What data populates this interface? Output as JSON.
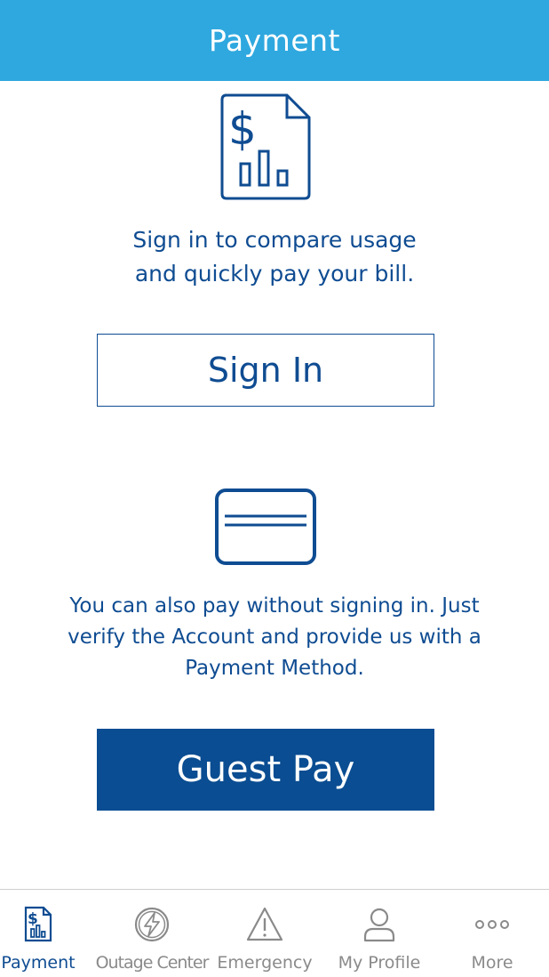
{
  "header": {
    "title": "Payment"
  },
  "signin_section": {
    "icon": "bill-usage-icon",
    "text_line1": "Sign in to compare usage",
    "text_line2": "and quickly pay your bill.",
    "button_label": "Sign In"
  },
  "guest_section": {
    "icon": "credit-card-icon",
    "text_line1": "You can also pay without signing in. Just",
    "text_line2": "verify the Account and provide us with a",
    "text_line3": "Payment Method.",
    "button_label": "Guest Pay"
  },
  "tabbar": {
    "items": [
      {
        "label": "Payment",
        "icon": "bill-usage-icon",
        "active": true
      },
      {
        "label": "Outage Center",
        "icon": "lightning-icon",
        "active": false
      },
      {
        "label": "Emergency",
        "icon": "warning-triangle-icon",
        "active": false
      },
      {
        "label": "My Profile",
        "icon": "user-icon",
        "active": false
      },
      {
        "label": "More",
        "icon": "more-dots-icon",
        "active": false
      }
    ]
  },
  "colors": {
    "header_bg": "#2fa8df",
    "primary_text": "#0f4c92",
    "guest_button_bg": "#0a4d92",
    "inactive_tab": "#8a8a8a"
  }
}
